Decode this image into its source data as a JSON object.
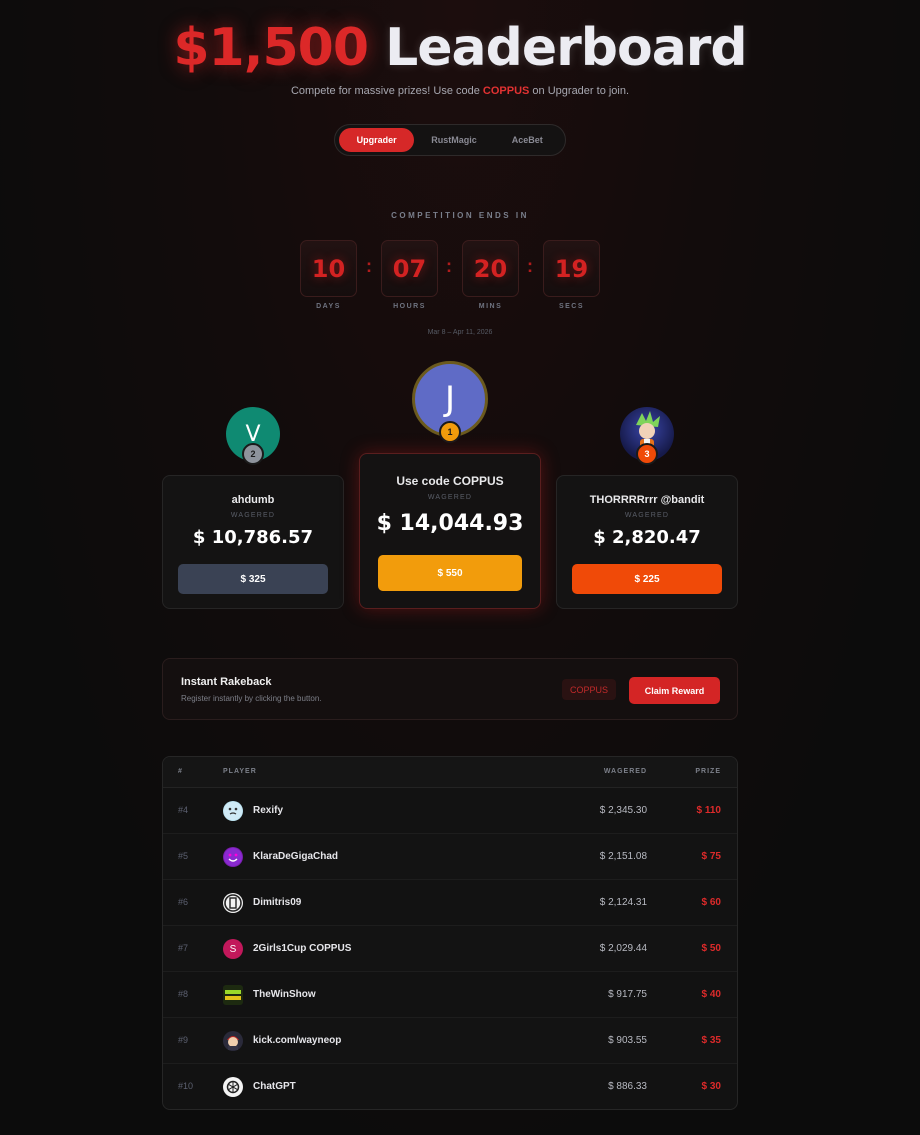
{
  "header": {
    "amount": "$1,500",
    "word": "Leaderboard",
    "subtitle_pre": "Compete for massive prizes! Use code ",
    "subtitle_code": "COPPUS",
    "subtitle_post": " on Upgrader to join."
  },
  "tabs": [
    {
      "label": "Upgrader",
      "active": true
    },
    {
      "label": "RustMagic",
      "active": false
    },
    {
      "label": "AceBet",
      "active": false
    }
  ],
  "countdown": {
    "label": "COMPETITION ENDS IN",
    "days": "10",
    "hours": "07",
    "mins": "20",
    "secs": "19",
    "days_label": "DAYS",
    "hours_label": "HOURS",
    "mins_label": "MINS",
    "secs_label": "SECS",
    "colon": ":",
    "date_range": "Mar 8 – Apr 11, 2026"
  },
  "podium": {
    "first": {
      "initial": "J",
      "rank": "1",
      "name": "Use code COPPUS",
      "wagered_label": "WAGERED",
      "amount": "$ 14,044.93",
      "prize": "$ 550"
    },
    "second": {
      "initial": "V",
      "rank": "2",
      "name": "ahdumb",
      "wagered_label": "WAGERED",
      "amount": "$ 10,786.57",
      "prize": "$ 325"
    },
    "third": {
      "rank": "3",
      "name": "THORRRRrrr @bandit",
      "wagered_label": "WAGERED",
      "amount": "$ 2,820.47",
      "prize": "$ 225"
    }
  },
  "rakeback": {
    "title": "Instant Rakeback",
    "subtitle": "Register instantly by clicking the button.",
    "code": "COPPUS",
    "button": "Claim Reward"
  },
  "table": {
    "headers": {
      "rank": "#",
      "player": "PLAYER",
      "wagered": "WAGERED",
      "prize": "PRIZE"
    },
    "rows": [
      {
        "rank": "#4",
        "player": "Rexify",
        "wagered": "$ 2,345.30",
        "prize": "$ 110"
      },
      {
        "rank": "#5",
        "player": "KlaraDeGigaChad",
        "wagered": "$ 2,151.08",
        "prize": "$ 75"
      },
      {
        "rank": "#6",
        "player": "Dimitris09",
        "wagered": "$ 2,124.31",
        "prize": "$ 60"
      },
      {
        "rank": "#7",
        "player": "2Girls1Cup COPPUS",
        "wagered": "$ 2,029.44",
        "prize": "$ 50",
        "initial": "S"
      },
      {
        "rank": "#8",
        "player": "TheWinShow",
        "wagered": "$ 917.75",
        "prize": "$ 40"
      },
      {
        "rank": "#9",
        "player": "kick.com/wayneop",
        "wagered": "$ 903.55",
        "prize": "$ 35"
      },
      {
        "rank": "#10",
        "player": "ChatGPT",
        "wagered": "$ 886.33",
        "prize": "$ 30"
      }
    ]
  },
  "colors": {
    "accent_red": "#d62828",
    "gold": "#f29c0c",
    "orange_red": "#f04a08",
    "slate": "#3a4254"
  }
}
